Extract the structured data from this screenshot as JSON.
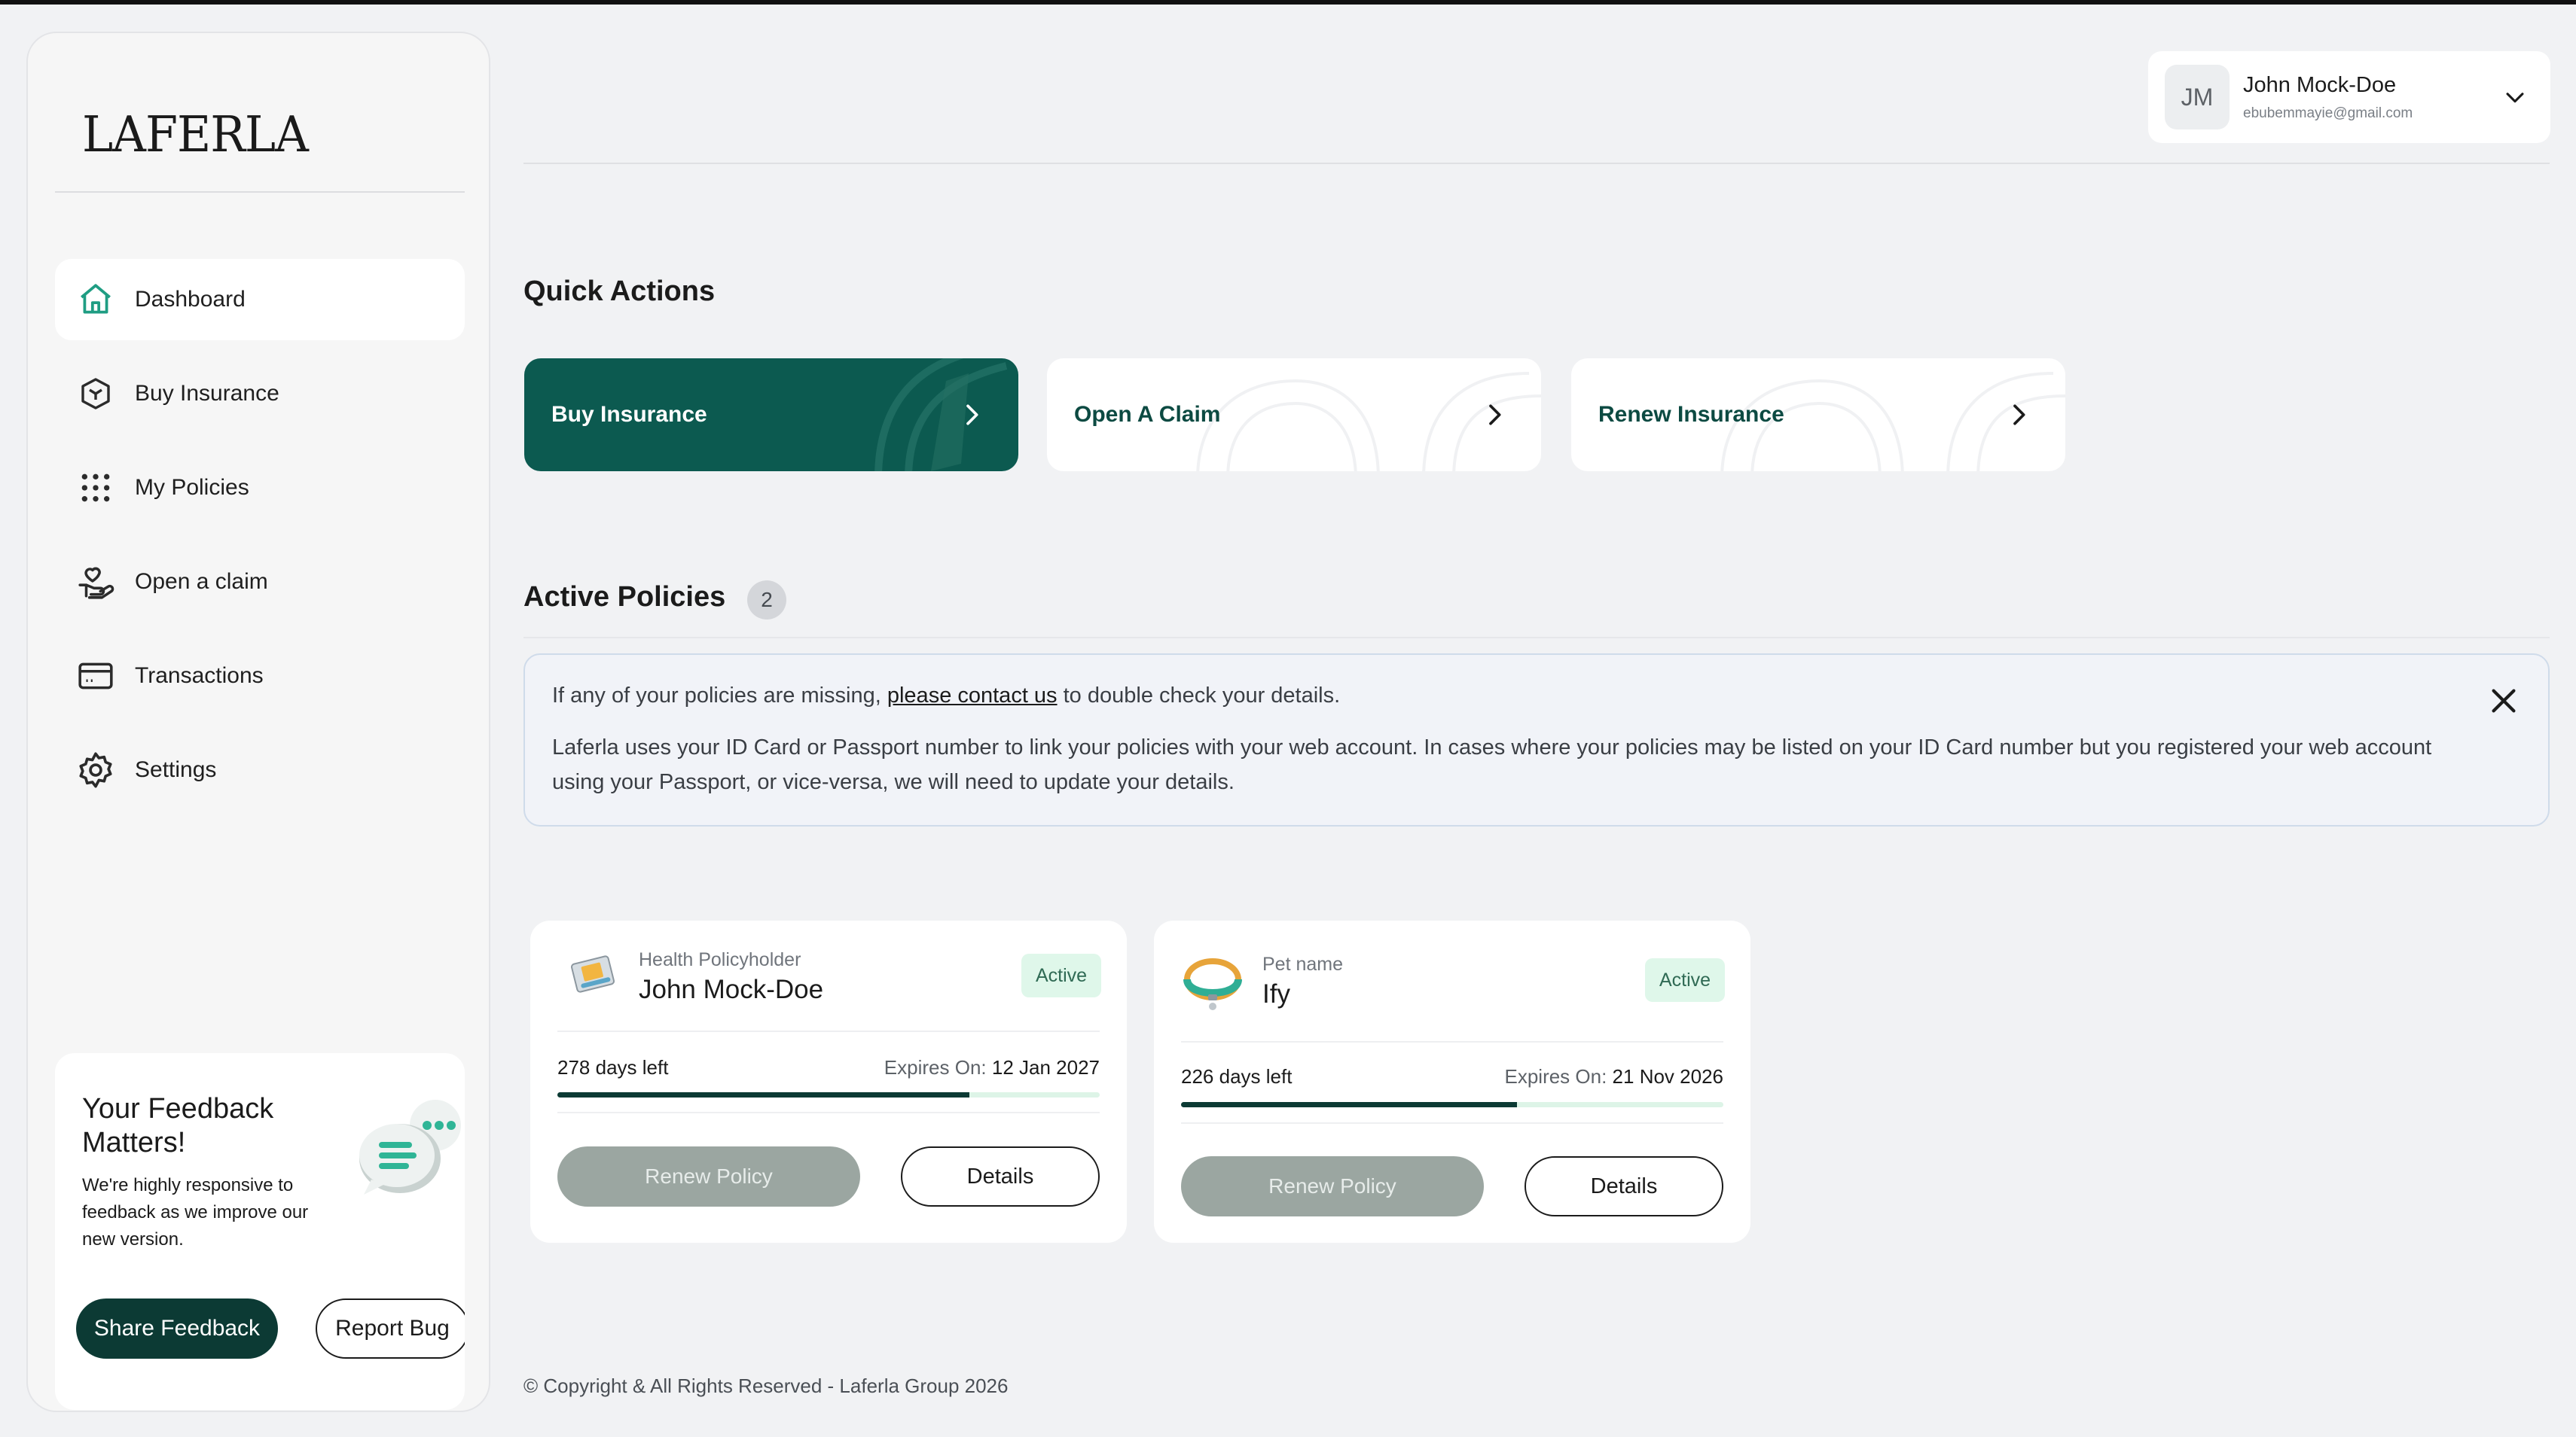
{
  "brand": {
    "logo_text": "LAFERLA"
  },
  "sidebar": {
    "items": [
      {
        "label": "Dashboard",
        "icon": "home-icon",
        "active": true
      },
      {
        "label": "Buy Insurance",
        "icon": "box-icon",
        "active": false
      },
      {
        "label": "My Policies",
        "icon": "grid-dots-icon",
        "active": false
      },
      {
        "label": "Open a claim",
        "icon": "hand-heart-icon",
        "active": false
      },
      {
        "label": "Transactions",
        "icon": "card-icon",
        "active": false
      },
      {
        "label": "Settings",
        "icon": "gear-icon",
        "active": false
      }
    ],
    "feedback": {
      "title": "Your Feedback Matters!",
      "text": "We're highly responsive to feedback as we improve our new version.",
      "share_label": "Share Feedback",
      "report_label": "Report Bug"
    }
  },
  "header": {
    "user": {
      "initials": "JM",
      "name": "John Mock-Doe",
      "email": "ebubemmayie@gmail.com"
    }
  },
  "quick_actions": {
    "title": "Quick Actions",
    "items": [
      {
        "label": "Buy Insurance",
        "style": "primary"
      },
      {
        "label": "Open A Claim",
        "style": "white"
      },
      {
        "label": "Renew Insurance",
        "style": "white"
      }
    ]
  },
  "active_policies": {
    "title": "Active Policies",
    "count": "2",
    "notice": {
      "line1_before": "If any of your policies are missing, ",
      "line1_link": "please contact us",
      "line1_after": " to double check your details.",
      "line2": "Laferla uses your ID Card or Passport number to link your policies with your web account. In cases where your policies may be listed on your ID Card number but you registered your web account using your Passport, or vice-versa, we will need to update your details."
    },
    "policies": [
      {
        "label": "Health Policyholder",
        "name": "John Mock-Doe",
        "status": "Active",
        "days_left": "278 days left",
        "expires_label": "Expires On:",
        "expires_date": "12 Jan 2027",
        "progress": 0.76,
        "renew_label": "Renew Policy",
        "details_label": "Details",
        "icon": "health-card-icon"
      },
      {
        "label": "Pet name",
        "name": "Ify",
        "status": "Active",
        "days_left": "226 days left",
        "expires_label": "Expires On:",
        "expires_date": "21 Nov 2026",
        "progress": 0.62,
        "renew_label": "Renew Policy",
        "details_label": "Details",
        "icon": "pet-collar-icon"
      }
    ]
  },
  "footer": {
    "text": "© Copyright & All Rights Reserved - Laferla Group 2026"
  },
  "colors": {
    "accent": "#0c5a50",
    "dark_accent": "#0c3a34",
    "badge_bg": "#dff7ea",
    "background": "#f1f2f4"
  }
}
